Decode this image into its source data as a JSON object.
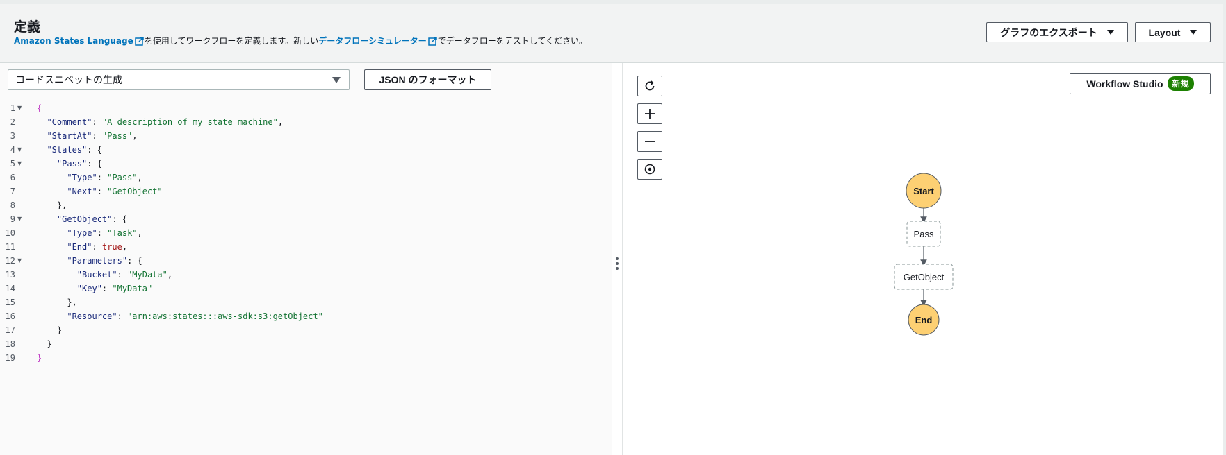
{
  "header": {
    "title": "定義",
    "link1": "Amazon States Language",
    "text1": "を使用してワークフローを定義します。新しい",
    "link2": "データフローシミュレーター",
    "text2": "でデータフローをテストしてください。",
    "export_label": "グラフのエクスポート",
    "layout_label": "Layout"
  },
  "editor": {
    "snippet_select": "コードスニペットの生成",
    "format_button": "JSON のフォーマット",
    "lines": [
      {
        "n": "1",
        "fold": true,
        "text": "{"
      },
      {
        "n": "2",
        "fold": false,
        "text": "  \"Comment\": \"A description of my state machine\","
      },
      {
        "n": "3",
        "fold": false,
        "text": "  \"StartAt\": \"Pass\","
      },
      {
        "n": "4",
        "fold": true,
        "text": "  \"States\": {"
      },
      {
        "n": "5",
        "fold": true,
        "text": "    \"Pass\": {"
      },
      {
        "n": "6",
        "fold": false,
        "text": "      \"Type\": \"Pass\","
      },
      {
        "n": "7",
        "fold": false,
        "text": "      \"Next\": \"GetObject\""
      },
      {
        "n": "8",
        "fold": false,
        "text": "    },"
      },
      {
        "n": "9",
        "fold": true,
        "text": "    \"GetObject\": {"
      },
      {
        "n": "10",
        "fold": false,
        "text": "      \"Type\": \"Task\","
      },
      {
        "n": "11",
        "fold": false,
        "text": "      \"End\": true,"
      },
      {
        "n": "12",
        "fold": true,
        "text": "      \"Parameters\": {"
      },
      {
        "n": "13",
        "fold": false,
        "text": "        \"Bucket\": \"MyData\","
      },
      {
        "n": "14",
        "fold": false,
        "text": "        \"Key\": \"MyData\""
      },
      {
        "n": "15",
        "fold": false,
        "text": "      },"
      },
      {
        "n": "16",
        "fold": false,
        "text": "      \"Resource\": \"arn:aws:states:::aws-sdk:s3:getObject\""
      },
      {
        "n": "17",
        "fold": false,
        "text": "    }"
      },
      {
        "n": "18",
        "fold": false,
        "text": "  }"
      },
      {
        "n": "19",
        "fold": false,
        "text": "}"
      }
    ]
  },
  "graph": {
    "workflow_studio_label": "Workflow Studio",
    "new_badge": "新規",
    "controls": [
      "refresh-icon",
      "zoom-in-icon",
      "zoom-out-icon",
      "center-icon"
    ],
    "nodes": {
      "start": "Start",
      "pass": "Pass",
      "getobject": "GetObject",
      "end": "End"
    },
    "colors": {
      "terminal_fill": "#fdd073",
      "accent_link": "#0073bb",
      "badge": "#1d8102"
    }
  }
}
